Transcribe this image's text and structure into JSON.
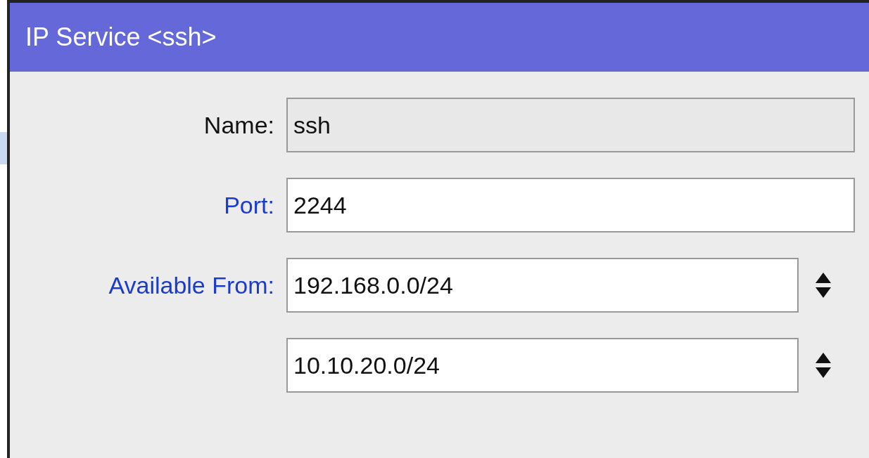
{
  "window": {
    "title": "IP Service <ssh>"
  },
  "fields": [
    {
      "label": "Name:",
      "value": "ssh",
      "disabled": true,
      "highlighted": false,
      "kind": "text"
    },
    {
      "label": "Port:",
      "value": "2244",
      "disabled": false,
      "highlighted": true,
      "kind": "text"
    },
    {
      "label": "Available From:",
      "value": "192.168.0.0/24",
      "disabled": false,
      "highlighted": true,
      "kind": "list"
    },
    {
      "value": "10.10.20.0/24",
      "disabled": false,
      "kind": "list"
    }
  ]
}
